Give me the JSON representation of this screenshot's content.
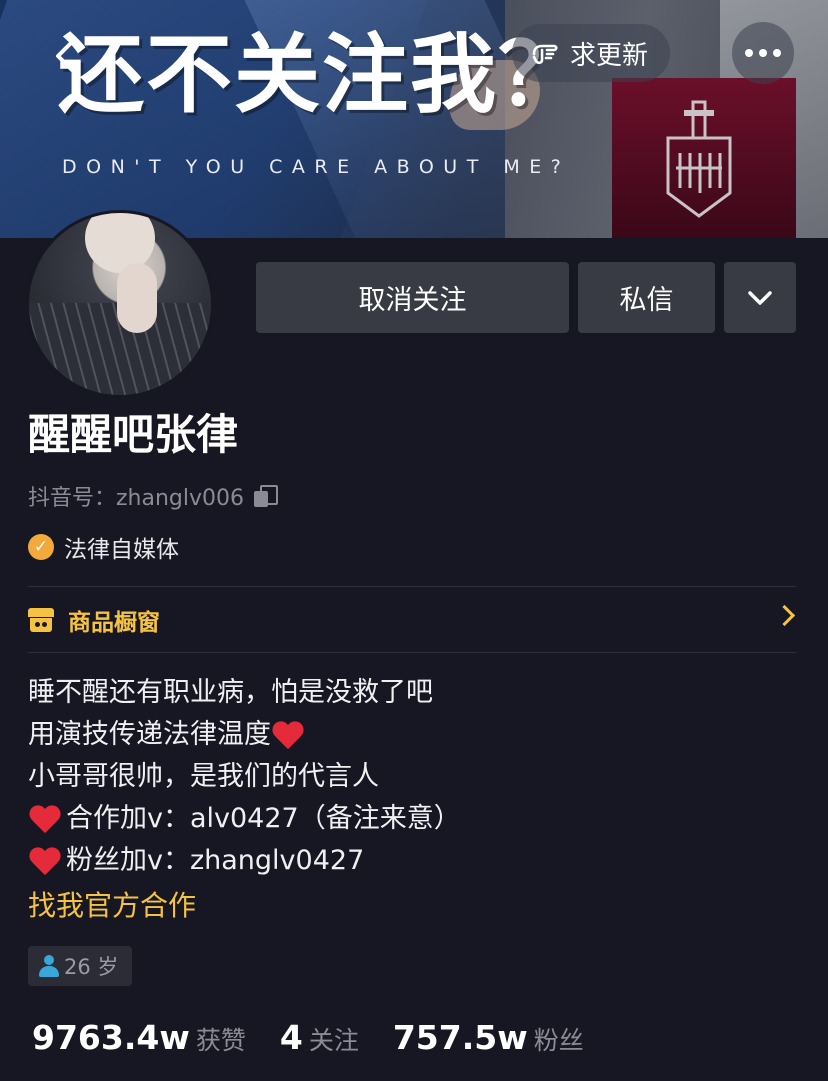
{
  "header": {
    "banner_title": "还不关注我？",
    "banner_subtitle": "DON'T YOU CARE ABOUT ME?",
    "refresh_label": "求更新",
    "back_icon": "chevron-left-icon",
    "more_icon": "more-horizontal-icon"
  },
  "actions": {
    "unfollow_label": "取消关注",
    "message_label": "私信",
    "dropdown_icon": "chevron-down-icon"
  },
  "profile": {
    "nickname": "醒醒吧张律",
    "account_id": "抖音号：zhanglv006",
    "verified_label": "法律自媒体"
  },
  "shop": {
    "label": "商品橱窗"
  },
  "bio": {
    "line1": "睡不醒还有职业病，怕是没救了吧",
    "line2": "用演技传递法律温度",
    "line3": "小哥哥很帅，是我们的代言人",
    "line4": "合作加v：alv0427（备注来意）",
    "line5": "粉丝加v：zhanglv0427",
    "link": "找我官方合作"
  },
  "tags": {
    "age": "26 岁"
  },
  "stats": {
    "likes_value": "9763.4w",
    "likes_label": "获赞",
    "following_value": "4",
    "following_label": "关注",
    "followers_value": "757.5w",
    "followers_label": "粉丝"
  },
  "colors": {
    "background": "#161722",
    "accent": "#f5c242",
    "button": "#393b44",
    "heart": "#e52a3a",
    "muted_text": "#8a8b93"
  }
}
